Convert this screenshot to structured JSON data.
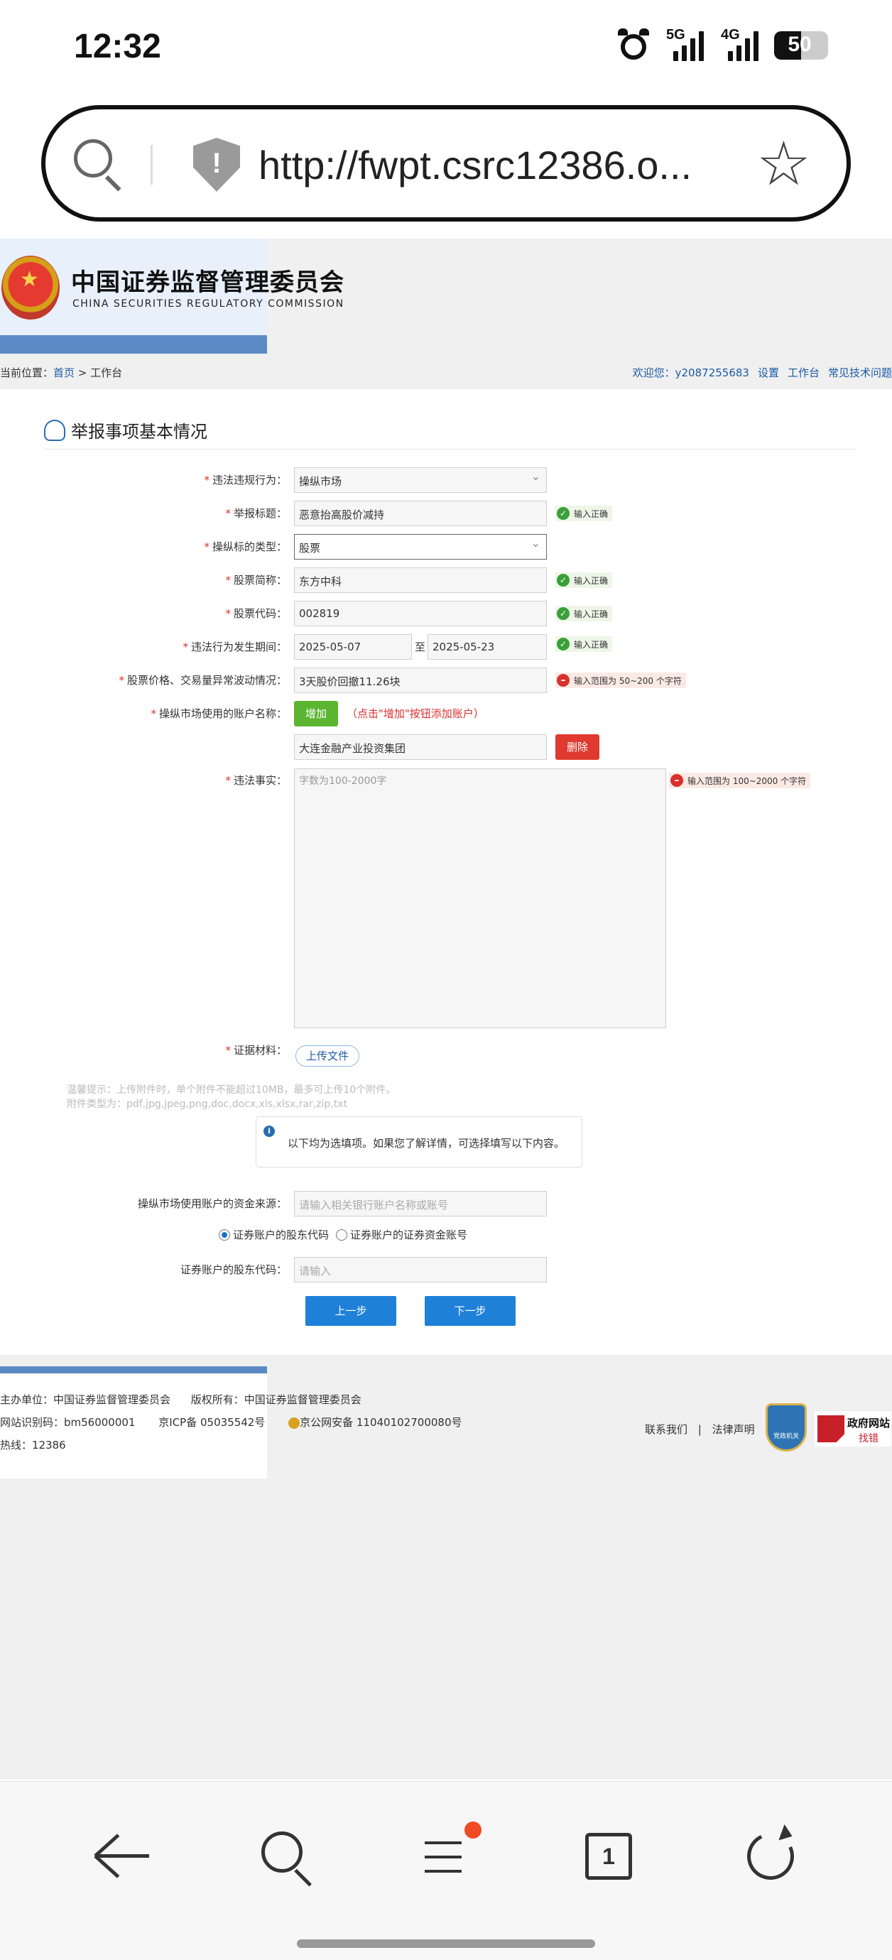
{
  "status": {
    "time": "12:32",
    "net1": "5G",
    "net2": "4G",
    "battery": "50",
    "battery_level": 0.5
  },
  "browser": {
    "url": "http://fwpt.csrc12386.o..."
  },
  "header": {
    "org_cn": "中国证券监督管理委员会",
    "org_en": "CHINA SECURITIES REGULATORY COMMISSION"
  },
  "breadcrumb": {
    "prefix": "当前位置：",
    "home": "首页",
    "sep": " > ",
    "current": "工作台"
  },
  "userlinks": {
    "welcome": "欢迎您：y2087255683",
    "settings": "设置",
    "workbench": "工作台",
    "faq": "常见技术问题"
  },
  "section": {
    "title": "举报事项基本情况"
  },
  "form": {
    "violation_label": "违法违规行为：",
    "violation_value": "操纵市场",
    "title_label": "举报标题：",
    "title_value": "恶意抬高股价减持",
    "ok_text": "输入正确",
    "target_type_label": "操纵标的类型：",
    "target_type_value": "股票",
    "stock_name_label": "股票简称：",
    "stock_name_value": "东方中科",
    "stock_code_label": "股票代码：",
    "stock_code_value": "002819",
    "period_label": "违法行为发生期间：",
    "period_start": "2025-05-07",
    "period_to": "至",
    "period_end": "2025-05-23",
    "price_label": "股票价格、交易量异常波动情况：",
    "price_value": "3天股价回撤11.26块",
    "price_error": "输入范围为 50~200 个字符",
    "account_label": "操纵市场使用的账户名称：",
    "add_button": "增加",
    "add_hint": "（点击\"增加\"按钮添加账户）",
    "account_value": "大连金融产业投资集团",
    "delete_button": "删除",
    "facts_label": "违法事实：",
    "facts_placeholder": "字数为100-2000字",
    "facts_error": "输入范围为 100~2000 个字符",
    "evidence_label": "证据材料：",
    "upload_button": "上传文件",
    "tip1": "温馨提示：上传附件时，单个附件不能超过10MB，最多可上传10个附件。",
    "tip2": "附件类型为：pdf,jpg,jpeg,png,doc,docx,xls,xlsx,rar,zip,txt",
    "info_text": "以下均为选填项。如果您了解详情，可选择填写以下内容。",
    "fund_label": "操纵市场使用账户的资金来源：",
    "fund_placeholder": "请输入相关银行账户名称或账号",
    "radio1": "证券账户的股东代码",
    "radio2": "证券账户的证券资金账号",
    "holder_label": "证券账户的股东代码：",
    "holder_placeholder": "请输入",
    "prev_button": "上一步",
    "next_button": "下一步"
  },
  "footer": {
    "host": "主办单位：中国证券监督管理委员会",
    "copyright": "版权所有：中国证券监督管理委员会",
    "site_id": "网站识别码：bm56000001",
    "icp": "京ICP备 05035542号",
    "police": "京公网安备 11040102700080号",
    "hotline": "热线：12386",
    "contact": "联系我们",
    "legal": "法律声明",
    "badge1": "党政机关",
    "badge2_title": "政府网站",
    "badge2_sub": "找错"
  },
  "nav": {
    "tab_count": "1"
  }
}
